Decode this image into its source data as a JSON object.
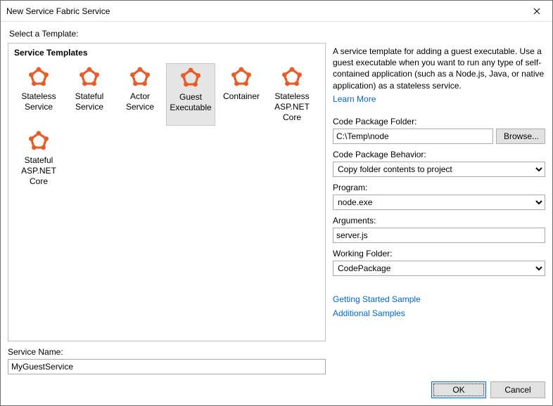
{
  "title": "New Service Fabric Service",
  "prompt": "Select a Template:",
  "templates_header": "Service Templates",
  "templates": [
    {
      "label": "Stateless\nService",
      "selected": false
    },
    {
      "label": "Stateful\nService",
      "selected": false
    },
    {
      "label": "Actor Service",
      "selected": false
    },
    {
      "label": "Guest\nExecutable",
      "selected": true
    },
    {
      "label": "Container",
      "selected": false
    },
    {
      "label": "Stateless\nASP.NET\nCore",
      "selected": false
    },
    {
      "label": "Stateful\nASP.NET\nCore",
      "selected": false
    }
  ],
  "description": "A service template for adding a guest executable. Use a guest executable when you want to run any type of self-contained application (such as a Node.js, Java, or native application) as a stateless service.",
  "learn_more": "Learn More",
  "fields": {
    "code_pkg_folder": {
      "label": "Code Package Folder:",
      "value": "C:\\Temp\\node",
      "browse": "Browse..."
    },
    "code_pkg_behavior": {
      "label": "Code Package Behavior:",
      "value": "Copy folder contents to project"
    },
    "program": {
      "label": "Program:",
      "value": "node.exe"
    },
    "arguments": {
      "label": "Arguments:",
      "value": "server.js"
    },
    "working_folder": {
      "label": "Working Folder:",
      "value": "CodePackage"
    }
  },
  "extra_links": {
    "getting_started": "Getting Started Sample",
    "additional_samples": "Additional Samples"
  },
  "service_name": {
    "label": "Service Name:",
    "value": "MyGuestService"
  },
  "buttons": {
    "ok": "OK",
    "cancel": "Cancel"
  }
}
